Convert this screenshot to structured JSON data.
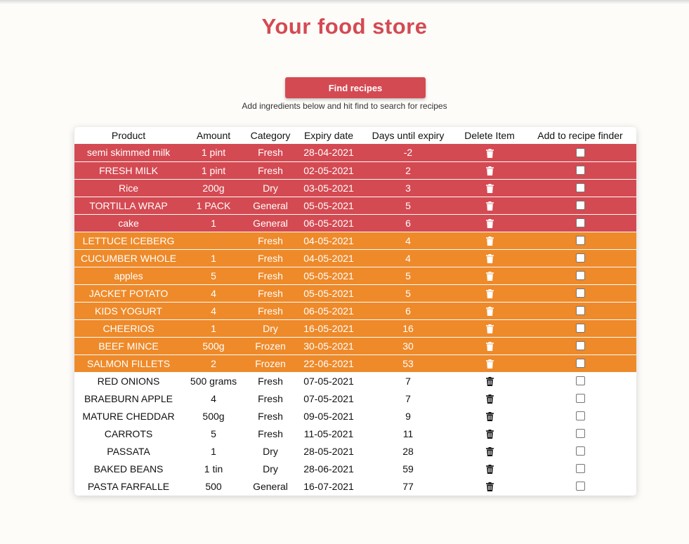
{
  "page": {
    "title": "Your food store",
    "find_button": "Find recipes",
    "hint": "Add ingredients below and hit find to search for recipes"
  },
  "colors": {
    "accent": "#d44a52",
    "warning": "#ee8a2a",
    "background": "#fdfcf9"
  },
  "table": {
    "headers": [
      "Product",
      "Amount",
      "Category",
      "Expiry date",
      "Days until expiry",
      "Delete Item",
      "Add to recipe finder"
    ],
    "rows": [
      {
        "product": "semi skimmed milk",
        "amount": "1 pint",
        "category": "Fresh",
        "expiry": "28-04-2021",
        "days": "-2",
        "status": "urgent"
      },
      {
        "product": "FRESH MILK",
        "amount": "1 pint",
        "category": "Fresh",
        "expiry": "02-05-2021",
        "days": "2",
        "status": "urgent"
      },
      {
        "product": "Rice",
        "amount": "200g",
        "category": "Dry",
        "expiry": "03-05-2021",
        "days": "3",
        "status": "urgent"
      },
      {
        "product": "TORTILLA WRAP",
        "amount": "1 PACK",
        "category": "General",
        "expiry": "05-05-2021",
        "days": "5",
        "status": "urgent"
      },
      {
        "product": "cake",
        "amount": "1",
        "category": "General",
        "expiry": "06-05-2021",
        "days": "6",
        "status": "urgent"
      },
      {
        "product": "LETTUCE ICEBERG",
        "amount": "",
        "category": "Fresh",
        "expiry": "04-05-2021",
        "days": "4",
        "status": "soon"
      },
      {
        "product": "CUCUMBER WHOLE",
        "amount": "1",
        "category": "Fresh",
        "expiry": "04-05-2021",
        "days": "4",
        "status": "soon"
      },
      {
        "product": "apples",
        "amount": "5",
        "category": "Fresh",
        "expiry": "05-05-2021",
        "days": "5",
        "status": "soon"
      },
      {
        "product": "JACKET POTATO",
        "amount": "4",
        "category": "Fresh",
        "expiry": "05-05-2021",
        "days": "5",
        "status": "soon"
      },
      {
        "product": "KIDS YOGURT",
        "amount": "4",
        "category": "Fresh",
        "expiry": "06-05-2021",
        "days": "6",
        "status": "soon"
      },
      {
        "product": "CHEERIOS",
        "amount": "1",
        "category": "Dry",
        "expiry": "16-05-2021",
        "days": "16",
        "status": "soon"
      },
      {
        "product": "BEEF MINCE",
        "amount": "500g",
        "category": "Frozen",
        "expiry": "30-05-2021",
        "days": "30",
        "status": "soon"
      },
      {
        "product": "SALMON FILLETS",
        "amount": "2",
        "category": "Frozen",
        "expiry": "22-06-2021",
        "days": "53",
        "status": "soon"
      },
      {
        "product": "RED ONIONS",
        "amount": "500 grams",
        "category": "Fresh",
        "expiry": "07-05-2021",
        "days": "7",
        "status": "ok"
      },
      {
        "product": "BRAEBURN APPLE",
        "amount": "4",
        "category": "Fresh",
        "expiry": "07-05-2021",
        "days": "7",
        "status": "ok"
      },
      {
        "product": "MATURE CHEDDAR",
        "amount": "500g",
        "category": "Fresh",
        "expiry": "09-05-2021",
        "days": "9",
        "status": "ok"
      },
      {
        "product": "CARROTS",
        "amount": "5",
        "category": "Fresh",
        "expiry": "11-05-2021",
        "days": "11",
        "status": "ok"
      },
      {
        "product": "PASSATA",
        "amount": "1",
        "category": "Dry",
        "expiry": "28-05-2021",
        "days": "28",
        "status": "ok"
      },
      {
        "product": "BAKED BEANS",
        "amount": "1 tin",
        "category": "Dry",
        "expiry": "28-06-2021",
        "days": "59",
        "status": "ok"
      },
      {
        "product": "PASTA FARFALLE",
        "amount": "500",
        "category": "General",
        "expiry": "16-07-2021",
        "days": "77",
        "status": "ok"
      }
    ]
  },
  "icons": {
    "delete": "trash-icon",
    "select": "checkbox"
  }
}
